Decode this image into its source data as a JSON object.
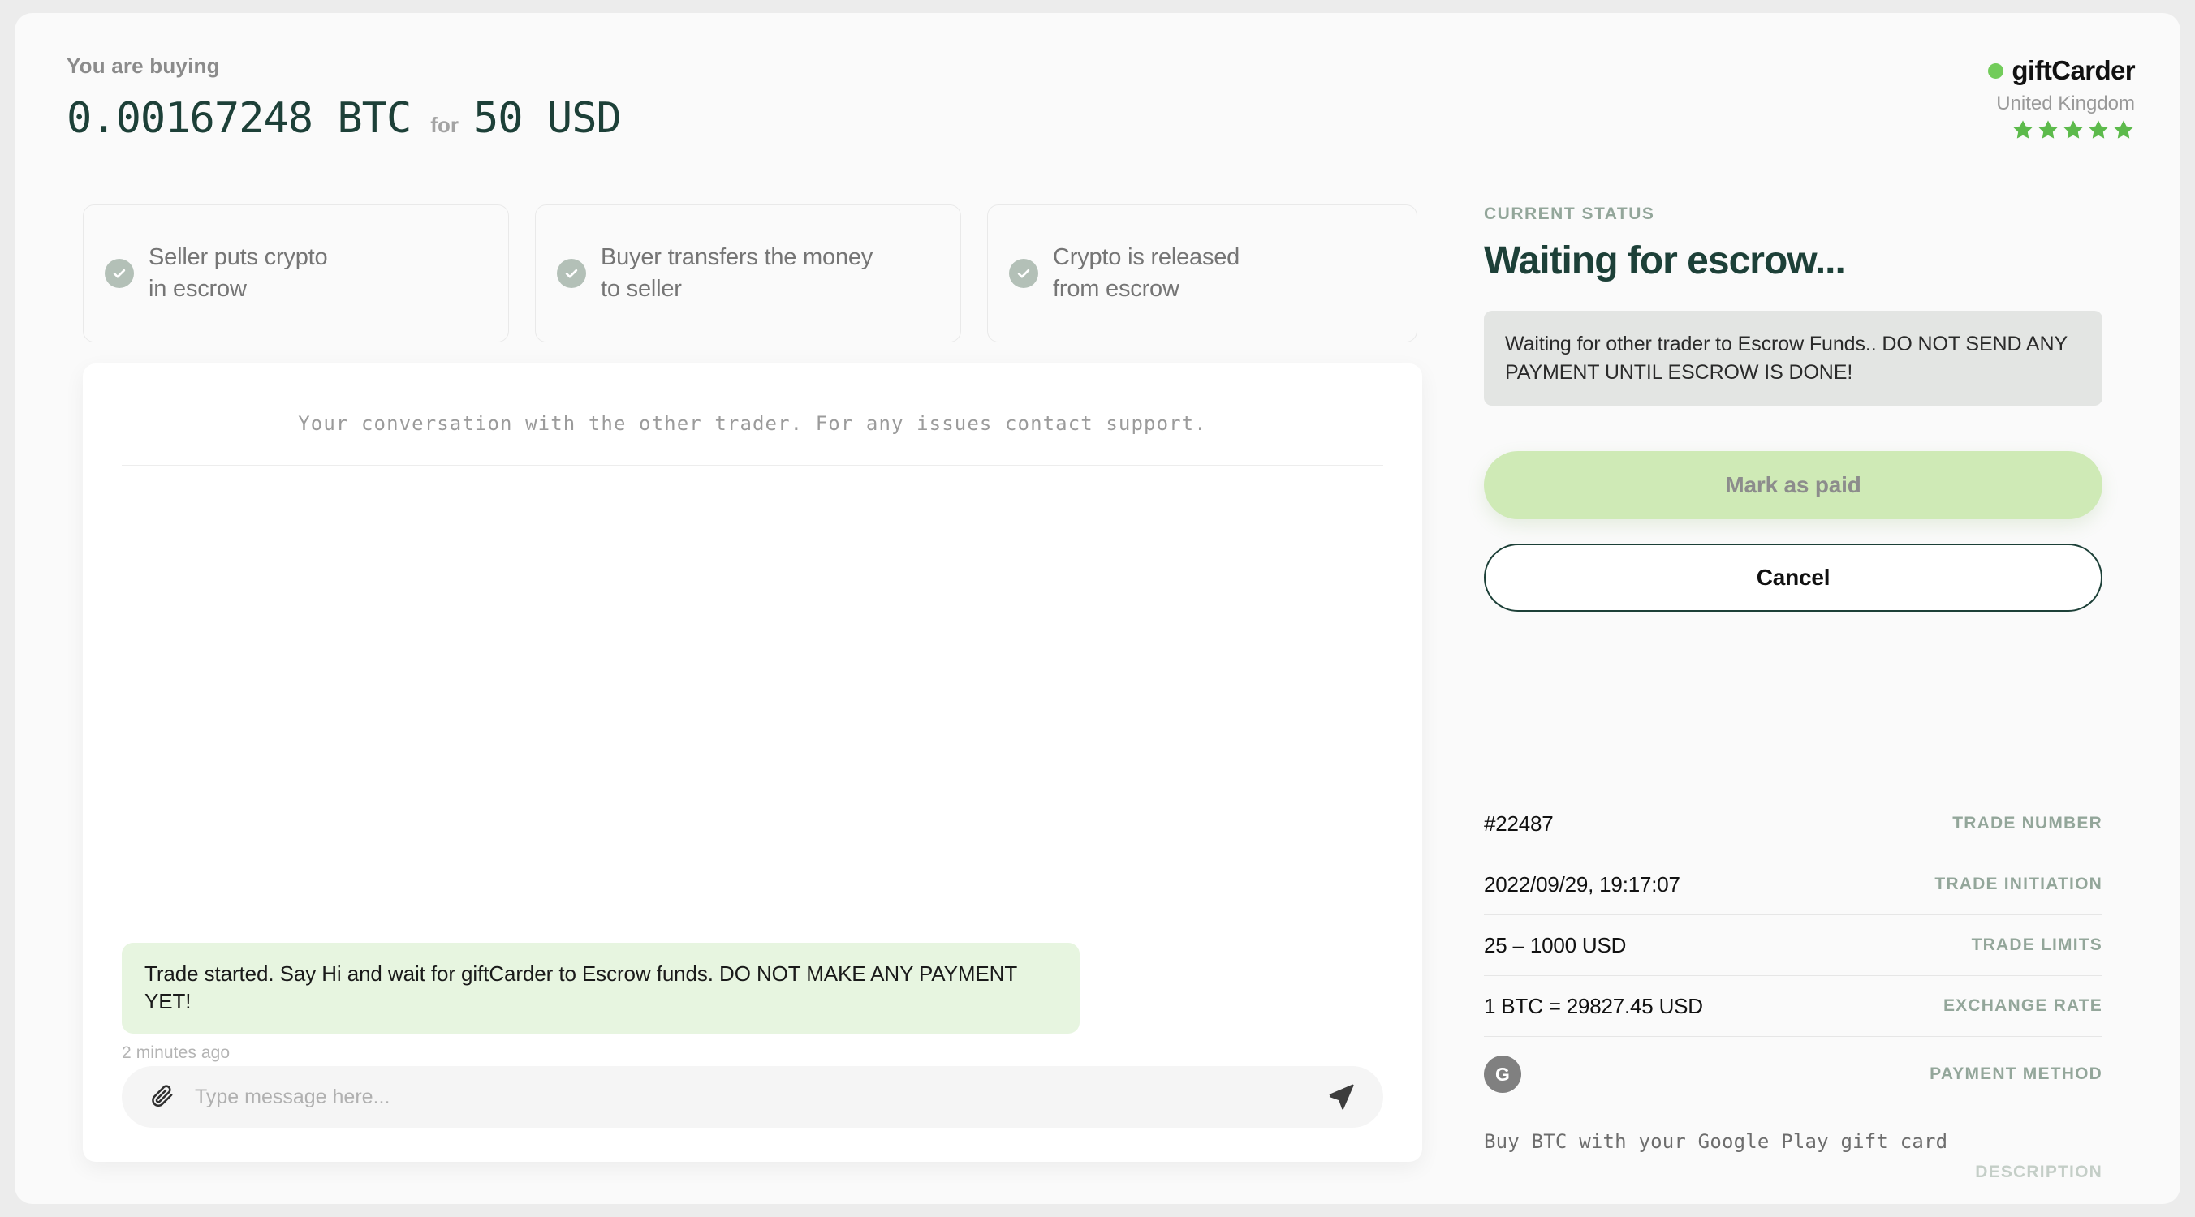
{
  "header": {
    "buying_label": "You are buying",
    "crypto_amount": "0.00167248 BTC",
    "for_label": "for",
    "fiat_amount": "50 USD"
  },
  "brand": {
    "name": "giftCarder",
    "country": "United Kingdom",
    "stars": 5,
    "dot_color": "#72cc5a",
    "star_color": "#5cba4b"
  },
  "steps": [
    {
      "line1": "Seller puts crypto",
      "line2": "in escrow",
      "state": "done"
    },
    {
      "line1": "Buyer transfers the money",
      "line2": "to seller",
      "state": "done"
    },
    {
      "line1": "Crypto is released",
      "line2": "from escrow",
      "state": "done"
    }
  ],
  "chat": {
    "note": "Your conversation with the other trader. For any issues contact support.",
    "messages": [
      {
        "text": "Trade started. Say Hi and wait for giftCarder to Escrow funds. DO NOT MAKE ANY PAYMENT YET!",
        "time": "2 minutes ago",
        "bubble_color": "#e7f5e0"
      }
    ],
    "composer": {
      "placeholder": "Type message here...",
      "value": "",
      "attach_icon": "paperclip-icon",
      "send_icon": "send-icon"
    }
  },
  "status": {
    "kicker": "CURRENT STATUS",
    "title": "Waiting for escrow...",
    "notice": "Waiting for other trader to Escrow Funds.. DO NOT SEND ANY PAYMENT UNTIL ESCROW IS DONE!",
    "primary_button": "Mark as paid",
    "secondary_button": "Cancel",
    "primary_color": "#cfeab6",
    "title_color": "#1d4038"
  },
  "details": {
    "trade_number": {
      "value": "#22487",
      "label": "TRADE NUMBER"
    },
    "trade_initiation": {
      "value": "2022/09/29, 19:17:07",
      "label": "TRADE INITIATION"
    },
    "trade_limits": {
      "value": "25 – 1000 USD",
      "label": "TRADE LIMITS"
    },
    "exchange_rate": {
      "value": "1 BTC = 29827.45 USD",
      "label": "EXCHANGE RATE"
    },
    "payment_method": {
      "badge": "G",
      "label": "PAYMENT METHOD"
    },
    "description": {
      "value": "Buy BTC with your Google Play gift card",
      "label": "DESCRIPTION"
    }
  }
}
